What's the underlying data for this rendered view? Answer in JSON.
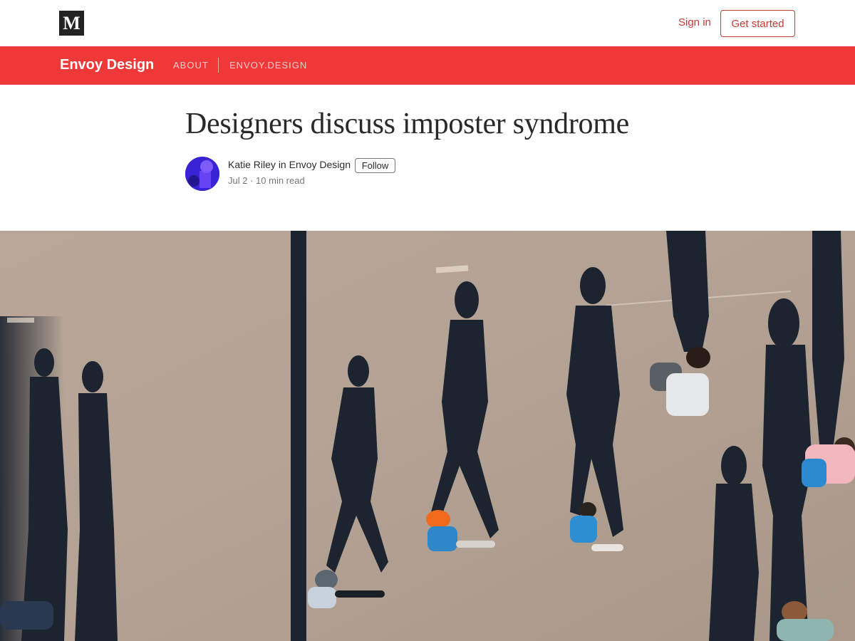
{
  "topbar": {
    "logo_letter": "M",
    "sign_in": "Sign in",
    "get_started": "Get started"
  },
  "publication": {
    "name": "Envoy Design",
    "nav": [
      "ABOUT",
      "ENVOY.DESIGN"
    ]
  },
  "article": {
    "title": "Designers discuss imposter syndrome",
    "author": "Katie Riley",
    "in_word": "in",
    "publication": "Envoy Design",
    "follow": "Follow",
    "date": "Jul 2",
    "read_time": "10 min read"
  },
  "colors": {
    "brand_red": "#ef3938",
    "link_red": "#c63a35",
    "pavement": "#b7a496",
    "shadow": "#1c2430"
  }
}
